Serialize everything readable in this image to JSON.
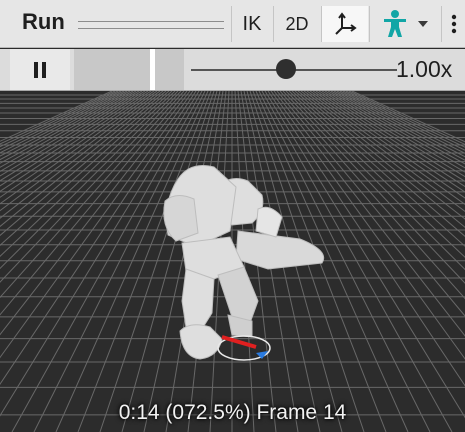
{
  "toolbar": {
    "title": "Run",
    "ik_label": "IK",
    "mode_2d_label": "2D",
    "icons": {
      "gizmo": "gizmo-axes-icon",
      "avatar": "avatar-icon",
      "dropdown": "chevron-down-icon",
      "more": "more-vertical-icon"
    }
  },
  "playback": {
    "pause_icon": "pause-icon",
    "speed_label": "1.00x",
    "speed_level_fraction": 0.45,
    "timeline_progress_percent": 72.5
  },
  "viewport": {
    "status_text": "0:14 (072.5%) Frame 14"
  },
  "colors": {
    "toolbar_bg": "#e6e6e6",
    "viewport_bg": "#2d2d2d",
    "avatar_accent": "#12a6a6",
    "axis_red": "#e02020",
    "axis_blue": "#2a7be0"
  }
}
